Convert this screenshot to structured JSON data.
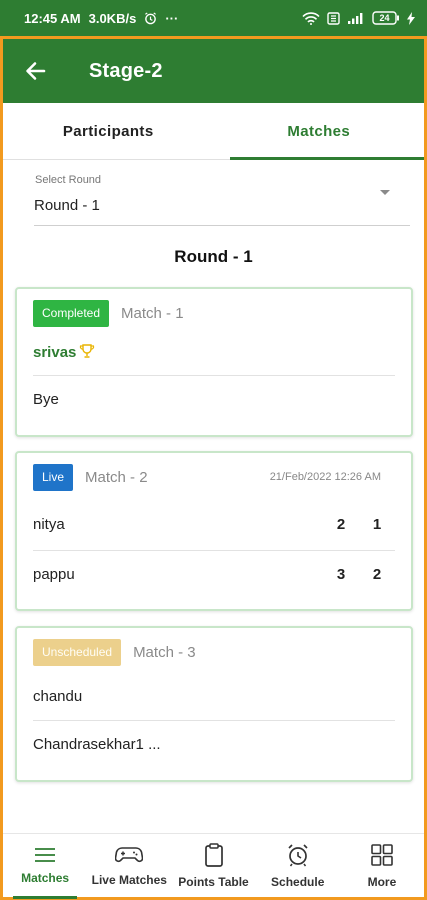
{
  "status_bar": {
    "time": "12:45 AM",
    "speed": "3.0KB/s",
    "more": "···",
    "battery": "24"
  },
  "app_bar": {
    "title": "Stage-2",
    "back_icon": "arrow-left-icon"
  },
  "tabs": [
    {
      "label": "Participants",
      "active": false
    },
    {
      "label": "Matches",
      "active": true
    }
  ],
  "round_select": {
    "label": "Select Round",
    "value": "Round - 1"
  },
  "round_heading": "Round - 1",
  "matches": [
    {
      "status": "Completed",
      "status_color": "#2fb543",
      "name": "Match - 1",
      "date": "",
      "players": [
        {
          "name": "srivas",
          "winner": true
        },
        {
          "name": "Bye",
          "winner": false
        }
      ]
    },
    {
      "status": "Live",
      "status_color": "#1f74c9",
      "name": "Match - 2",
      "date": "21/Feb/2022 12:26 AM",
      "players": [
        {
          "name": "nitya",
          "scores": [
            "2",
            "1"
          ]
        },
        {
          "name": "pappu",
          "scores": [
            "3",
            "2"
          ]
        }
      ]
    },
    {
      "status": "Unscheduled",
      "status_color": "#ecd08c",
      "name": "Match - 3",
      "date": "",
      "players": [
        {
          "name": "chandu"
        },
        {
          "name": "Chandrasekhar1 ..."
        }
      ]
    }
  ],
  "bottom_nav": [
    {
      "label": "Matches",
      "icon": "menu-lines-icon",
      "active": true
    },
    {
      "label": "Live Matches",
      "icon": "gamepad-icon",
      "active": false
    },
    {
      "label": "Points Table",
      "icon": "clipboard-icon",
      "active": false
    },
    {
      "label": "Schedule",
      "icon": "alarm-clock-icon",
      "active": false
    },
    {
      "label": "More",
      "icon": "grid-icon",
      "active": false
    }
  ],
  "colors": {
    "primary": "#2e7d32",
    "frame": "#f29a1f"
  }
}
